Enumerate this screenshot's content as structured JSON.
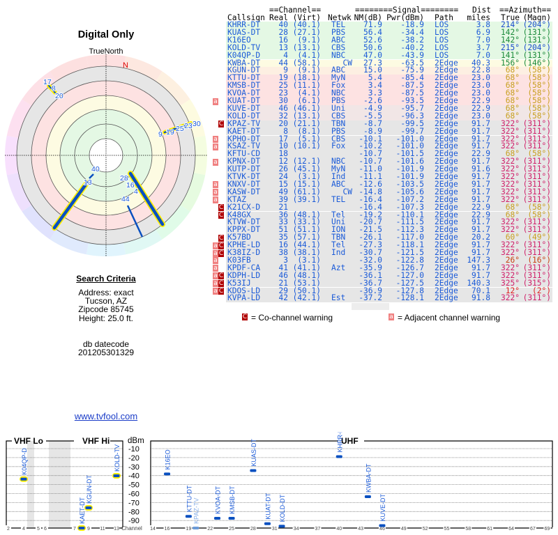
{
  "polar": {
    "title": "Digital Only",
    "north_label": "TrueNorth",
    "n_marker": "N",
    "labels": {
      "tl": [
        "17",
        "8",
        "20"
      ],
      "tr": [
        "9",
        "19",
        "25",
        "23",
        "30"
      ],
      "c": [
        "40",
        "13",
        "28",
        "16",
        "4",
        "44"
      ]
    }
  },
  "search": {
    "title": "Search Criteria",
    "address": "Address: exact",
    "city": "Tucson, AZ",
    "zipcode": "Zipcode 85745",
    "height": "Height: 25.0 ft.",
    "db_label": "db datecode",
    "db_value": "201205301329"
  },
  "link": "www.tvfool.com",
  "table": {
    "group_headers": {
      "channel": "==Channel==",
      "signal": "========Signal========",
      "dist": "Dist",
      "azimuth": "==Azimuth=="
    },
    "headers": [
      "Callsign",
      "Real",
      "(Virt)",
      "Netwk",
      "NM(dB)",
      "Pwr(dBm)",
      "Path",
      "miles",
      "True",
      "(Magn)"
    ],
    "rows": [
      {
        "call": "KHRR-DT",
        "real": "40",
        "virt": "(40.1)",
        "net": "TEL",
        "nm": "71.9",
        "pwr": "-18.9",
        "path": "LOS",
        "dist": "3.8",
        "true": "214°",
        "magn": "(204°)",
        "band": "green",
        "az": "blue",
        "warn": ""
      },
      {
        "call": "KUAS-DT",
        "real": "28",
        "virt": "(27.1)",
        "net": "PBS",
        "nm": "56.4",
        "pwr": "-34.4",
        "path": "LOS",
        "dist": "6.9",
        "true": "142°",
        "magn": "(131°)",
        "band": "green",
        "az": "green",
        "warn": ""
      },
      {
        "call": "K16EO",
        "real": "16",
        "virt": "(9.1)",
        "net": "ABC",
        "nm": "52.6",
        "pwr": "-38.2",
        "path": "LOS",
        "dist": "7.0",
        "true": "142°",
        "magn": "(131°)",
        "band": "green",
        "az": "green",
        "warn": ""
      },
      {
        "call": "KOLD-TV",
        "real": "13",
        "virt": "(13.1)",
        "net": "CBS",
        "nm": "50.6",
        "pwr": "-40.2",
        "path": "LOS",
        "dist": "3.7",
        "true": "215°",
        "magn": "(204°)",
        "band": "green",
        "az": "blue",
        "warn": ""
      },
      {
        "call": "K04QP-D",
        "real": "4",
        "virt": "(4.1)",
        "net": "NBC",
        "nm": "47.0",
        "pwr": "-43.9",
        "path": "LOS",
        "dist": "7.0",
        "true": "141°",
        "magn": "(131°)",
        "band": "green",
        "az": "green",
        "warn": ""
      },
      {
        "call": "KWBA-DT",
        "real": "44",
        "virt": "(58.1)",
        "net": "CW",
        "nm": "27.3",
        "pwr": "-63.5",
        "path": "2Edge",
        "dist": "40.3",
        "true": "156°",
        "magn": "(146°)",
        "band": "yellow",
        "az": "green",
        "warn": ""
      },
      {
        "call": "KGUN-DT",
        "real": "9",
        "virt": "(9.1)",
        "net": "ABC",
        "nm": "15.0",
        "pwr": "-75.9",
        "path": "2Edge",
        "dist": "22.8",
        "true": "68°",
        "magn": "(58°)",
        "band": "orange",
        "az": "gold",
        "warn": ""
      },
      {
        "call": "KTTU-DT",
        "real": "19",
        "virt": "(18.1)",
        "net": "MyN",
        "nm": "5.4",
        "pwr": "-85.4",
        "path": "2Edge",
        "dist": "23.0",
        "true": "68°",
        "magn": "(58°)",
        "band": "pink",
        "az": "gold",
        "warn": ""
      },
      {
        "call": "KMSB-DT",
        "real": "25",
        "virt": "(11.1)",
        "net": "Fox",
        "nm": "3.4",
        "pwr": "-87.5",
        "path": "2Edge",
        "dist": "23.0",
        "true": "68°",
        "magn": "(58°)",
        "band": "pink",
        "az": "gold",
        "warn": ""
      },
      {
        "call": "KVOA-DT",
        "real": "23",
        "virt": "(4.1)",
        "net": "NBC",
        "nm": "3.3",
        "pwr": "-87.5",
        "path": "2Edge",
        "dist": "23.0",
        "true": "68°",
        "magn": "(58°)",
        "band": "pink",
        "az": "gold",
        "warn": ""
      },
      {
        "call": "KUAT-DT",
        "real": "30",
        "virt": "(6.1)",
        "net": "PBS",
        "nm": "-2.6",
        "pwr": "-93.5",
        "path": "2Edge",
        "dist": "22.9",
        "true": "68°",
        "magn": "(58°)",
        "band": "pink",
        "az": "gold",
        "warn": "a"
      },
      {
        "call": "KUVE-DT",
        "real": "46",
        "virt": "(46.1)",
        "net": "Uni",
        "nm": "-4.9",
        "pwr": "-95.7",
        "path": "2Edge",
        "dist": "22.9",
        "true": "68°",
        "magn": "(58°)",
        "band": "pinkgray",
        "az": "gold",
        "warn": ""
      },
      {
        "call": "KOLD-DT",
        "real": "32",
        "virt": "(13.1)",
        "net": "CBS",
        "nm": "-5.5",
        "pwr": "-96.3",
        "path": "2Edge",
        "dist": "23.0",
        "true": "68°",
        "magn": "(58°)",
        "band": "pinkgray",
        "az": "gold",
        "warn": ""
      },
      {
        "call": "KPAZ-TV",
        "real": "20",
        "virt": "(21.1)",
        "net": "TBN",
        "nm": "-8.7",
        "pwr": "-99.5",
        "path": "2Edge",
        "dist": "91.7",
        "true": "322°",
        "magn": "(311°)",
        "band": "gray",
        "az": "magenta",
        "warn": "C"
      },
      {
        "call": "KAET-DT",
        "real": "8",
        "virt": "(8.1)",
        "net": "PBS",
        "nm": "-8.9",
        "pwr": "-99.7",
        "path": "2Edge",
        "dist": "91.7",
        "true": "322°",
        "magn": "(311°)",
        "band": "gray",
        "az": "magenta",
        "warn": ""
      },
      {
        "call": "KPHO-DT",
        "real": "17",
        "virt": "(5.1)",
        "net": "CBS",
        "nm": "-10.1",
        "pwr": "-101.0",
        "path": "2Edge",
        "dist": "91.7",
        "true": "322°",
        "magn": "(311°)",
        "band": "gray",
        "az": "magenta",
        "warn": "a"
      },
      {
        "call": "KSAZ-TV",
        "real": "10",
        "virt": "(10.1)",
        "net": "Fox",
        "nm": "-10.2",
        "pwr": "-101.0",
        "path": "2Edge",
        "dist": "91.7",
        "true": "322°",
        "magn": "(311°)",
        "band": "gray",
        "az": "magenta",
        "warn": "a"
      },
      {
        "call": "KFTU-CD",
        "real": "18",
        "virt": "",
        "net": "",
        "nm": "-10.7",
        "pwr": "-101.5",
        "path": "2Edge",
        "dist": "22.9",
        "true": "68°",
        "magn": "(58°)",
        "band": "gray",
        "az": "gold",
        "warn": ""
      },
      {
        "call": "KPNX-DT",
        "real": "12",
        "virt": "(12.1)",
        "net": "NBC",
        "nm": "-10.7",
        "pwr": "-101.6",
        "path": "2Edge",
        "dist": "91.7",
        "true": "322°",
        "magn": "(311°)",
        "band": "gray",
        "az": "magenta",
        "warn": "a"
      },
      {
        "call": "KUTP-DT",
        "real": "26",
        "virt": "(45.1)",
        "net": "MyN",
        "nm": "-11.0",
        "pwr": "-101.9",
        "path": "2Edge",
        "dist": "91.6",
        "true": "322°",
        "magn": "(311°)",
        "band": "gray",
        "az": "magenta",
        "warn": ""
      },
      {
        "call": "KTVK-DT",
        "real": "24",
        "virt": "(3.1)",
        "net": "Ind",
        "nm": "-11.1",
        "pwr": "-101.9",
        "path": "2Edge",
        "dist": "91.7",
        "true": "322°",
        "magn": "(311°)",
        "band": "gray",
        "az": "magenta",
        "warn": ""
      },
      {
        "call": "KNXV-DT",
        "real": "15",
        "virt": "(15.1)",
        "net": "ABC",
        "nm": "-12.6",
        "pwr": "-103.5",
        "path": "2Edge",
        "dist": "91.7",
        "true": "322°",
        "magn": "(311°)",
        "band": "gray",
        "az": "magenta",
        "warn": "a"
      },
      {
        "call": "KASW-DT",
        "real": "49",
        "virt": "(61.1)",
        "net": "CW",
        "nm": "-14.8",
        "pwr": "-105.6",
        "path": "2Edge",
        "dist": "91.7",
        "true": "322°",
        "magn": "(311°)",
        "band": "gray",
        "az": "magenta",
        "warn": "a"
      },
      {
        "call": "KTAZ",
        "real": "39",
        "virt": "(39.1)",
        "net": "TEL",
        "nm": "-16.4",
        "pwr": "-107.2",
        "path": "2Edge",
        "dist": "91.7",
        "true": "322°",
        "magn": "(311°)",
        "band": "gray",
        "az": "magenta",
        "warn": "a"
      },
      {
        "call": "K21CX-D",
        "real": "21",
        "virt": "",
        "net": "",
        "nm": "-16.4",
        "pwr": "-107.3",
        "path": "2Edge",
        "dist": "22.9",
        "true": "68°",
        "magn": "(58°)",
        "band": "gray",
        "az": "gold",
        "warn": "C"
      },
      {
        "call": "K48GX",
        "real": "36",
        "virt": "(48.1)",
        "net": "Tel",
        "nm": "-19.2",
        "pwr": "-110.1",
        "path": "2Edge",
        "dist": "22.9",
        "true": "68°",
        "magn": "(58°)",
        "band": "gray",
        "az": "gold",
        "warn": "C"
      },
      {
        "call": "KTVW-DT",
        "real": "33",
        "virt": "(33.1)",
        "net": "Uni",
        "nm": "-20.7",
        "pwr": "-111.5",
        "path": "2Edge",
        "dist": "91.7",
        "true": "322°",
        "magn": "(311°)",
        "band": "gray",
        "az": "magenta",
        "warn": ""
      },
      {
        "call": "KPPX-DT",
        "real": "51",
        "virt": "(51.1)",
        "net": "ION",
        "nm": "-21.5",
        "pwr": "-112.3",
        "path": "2Edge",
        "dist": "91.7",
        "true": "322°",
        "magn": "(311°)",
        "band": "gray",
        "az": "magenta",
        "warn": ""
      },
      {
        "call": "K57BD",
        "real": "35",
        "virt": "(57.1)",
        "net": "TBN",
        "nm": "-26.1",
        "pwr": "-117.0",
        "path": "2Edge",
        "dist": "20.2",
        "true": "60°",
        "magn": "(49°)",
        "band": "gray",
        "az": "gold",
        "warn": "C"
      },
      {
        "call": "KPHE-LD",
        "real": "16",
        "virt": "(44.1)",
        "net": "Tel",
        "nm": "-27.3",
        "pwr": "-118.1",
        "path": "2Edge",
        "dist": "91.7",
        "true": "322°",
        "magn": "(311°)",
        "band": "gray",
        "az": "magenta",
        "warn": "aC"
      },
      {
        "call": "K38IZ-D",
        "real": "38",
        "virt": "(38.1)",
        "net": "Ind",
        "nm": "-30.7",
        "pwr": "-121.5",
        "path": "2Edge",
        "dist": "91.7",
        "true": "322°",
        "magn": "(311°)",
        "band": "gray",
        "az": "magenta",
        "warn": "aC"
      },
      {
        "call": "K03FB",
        "real": "3",
        "virt": "(3.1)",
        "net": "",
        "nm": "-32.0",
        "pwr": "-122.8",
        "path": "2Edge",
        "dist": "147.3",
        "true": "26°",
        "magn": "(16°)",
        "band": "gray",
        "az": "orange",
        "warn": "a"
      },
      {
        "call": "KPDF-CA",
        "real": "41",
        "virt": "(41.1)",
        "net": "Azt",
        "nm": "-35.9",
        "pwr": "-126.7",
        "path": "2Edge",
        "dist": "91.7",
        "true": "322°",
        "magn": "(311°)",
        "band": "gray",
        "az": "magenta",
        "warn": "a"
      },
      {
        "call": "KDPH-LD",
        "real": "46",
        "virt": "(48.1)",
        "net": "",
        "nm": "-36.1",
        "pwr": "-127.0",
        "path": "2Edge",
        "dist": "91.7",
        "true": "322°",
        "magn": "(311°)",
        "band": "gray",
        "az": "magenta",
        "warn": "aC"
      },
      {
        "call": "K53IJ",
        "real": "21",
        "virt": "(53.1)",
        "net": "",
        "nm": "-36.7",
        "pwr": "-127.5",
        "path": "2Edge",
        "dist": "140.3",
        "true": "325°",
        "magn": "(315°)",
        "band": "gray",
        "az": "magenta",
        "warn": "aC"
      },
      {
        "call": "KDOS-LD",
        "real": "29",
        "virt": "(50.1)",
        "net": "",
        "nm": "-36.9",
        "pwr": "-127.8",
        "path": "2Edge",
        "dist": "70.1",
        "true": "12°",
        "magn": "(2°)",
        "band": "gray",
        "az": "red",
        "warn": "aC"
      },
      {
        "call": "KVPA-LD",
        "real": "42",
        "virt": "(42.1)",
        "net": "Est",
        "nm": "-37.2",
        "pwr": "-128.1",
        "path": "2Edge",
        "dist": "91.8",
        "true": "322°",
        "magn": "(311°)",
        "band": "gray",
        "az": "magenta",
        "warn": ""
      }
    ],
    "legend": {
      "co_symbol": "C",
      "co_text": "= Co-channel warning",
      "adj_symbol": "a",
      "adj_text": "= Adjacent channel warning"
    }
  },
  "colors": {
    "band": {
      "green": "#e4f8e4",
      "yellow": "#fdfbe2",
      "orange": "#fdefe2",
      "pink": "#fde2e2",
      "pinkgray": "#f1e6e6",
      "gray": "#e6e6e6"
    },
    "az": {
      "blue": "#1a4ccc",
      "green": "#1a8a3a",
      "gold": "#c8a020",
      "magenta": "#d0206a",
      "orange": "#c84010",
      "red": "#e02020"
    },
    "text": "#1a5ad8"
  },
  "spectrum": {
    "vhf_lo": "VHF Lo",
    "vhf_hi": "VHF Hi",
    "uhf": "UHF",
    "unit": "dBm",
    "channel_label": "Channel",
    "dbm_ticks": [
      "-10",
      "-20",
      "-30",
      "-40",
      "-50",
      "-60",
      "-70",
      "-80",
      "-90"
    ],
    "vhf_channel_ticks": [
      "2",
      "4",
      "5",
      "6",
      "7",
      "9",
      "11",
      "13"
    ],
    "uhf_channel_ticks": [
      "14",
      "16",
      "19",
      "22",
      "25",
      "28",
      "31",
      "34",
      "37",
      "40",
      "43",
      "46",
      "49",
      "52",
      "55",
      "58",
      "61",
      "64",
      "67",
      "69"
    ],
    "stations": [
      {
        "call": "K04QP-D",
        "ch": 4,
        "dbm": -43.9,
        "strong": true
      },
      {
        "call": "KAET-DT",
        "ch": 8,
        "dbm": -99.7,
        "strong": true
      },
      {
        "call": "KGUN-DT",
        "ch": 9,
        "dbm": -75.9,
        "strong": true
      },
      {
        "call": "KOLD-TV",
        "ch": 13,
        "dbm": -40.2,
        "strong": true
      },
      {
        "call": "K16EO",
        "ch": 16,
        "dbm": -38.2,
        "strong": false
      },
      {
        "call": "KTTU-DT",
        "ch": 19,
        "dbm": -85.4,
        "strong": false
      },
      {
        "call": "KPAZ-TV",
        "ch": 20,
        "dbm": -99.5,
        "strong": false,
        "faded": true
      },
      {
        "call": "KVOA-DT",
        "ch": 23,
        "dbm": -87.5,
        "strong": false
      },
      {
        "call": "KMSB-DT",
        "ch": 25,
        "dbm": -87.5,
        "strong": false
      },
      {
        "call": "KUAS-DT",
        "ch": 28,
        "dbm": -34.4,
        "strong": false
      },
      {
        "call": "KUAT-DT",
        "ch": 30,
        "dbm": -93.5,
        "strong": false
      },
      {
        "call": "KOLD-DT",
        "ch": 32,
        "dbm": -96.3,
        "strong": false
      },
      {
        "call": "KHRR-DT",
        "ch": 40,
        "dbm": -18.9,
        "strong": false
      },
      {
        "call": "KWBA-DT",
        "ch": 44,
        "dbm": -63.5,
        "strong": false
      },
      {
        "call": "KUVE-DT",
        "ch": 46,
        "dbm": -95.7,
        "strong": false
      }
    ]
  }
}
